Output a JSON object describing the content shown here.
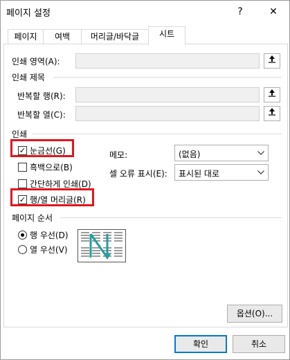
{
  "window": {
    "title": "페이지 설정",
    "help_label": "?",
    "close_label": "✕"
  },
  "tabs": [
    {
      "label": "페이지"
    },
    {
      "label": "여백"
    },
    {
      "label": "머리글/바닥글"
    },
    {
      "label": "시트"
    }
  ],
  "print_area": {
    "label": "인쇄 영역(A):",
    "value": ""
  },
  "print_titles": {
    "heading": "인쇄 제목",
    "rows_label": "반복할 행(R):",
    "cols_label": "반복할 열(C):"
  },
  "print": {
    "heading": "인쇄",
    "gridlines": {
      "label": "눈금선(G)",
      "checked": true
    },
    "black_white": {
      "label": "흑백으로(B)",
      "checked": false
    },
    "draft": {
      "label": "간단하게 인쇄(D)",
      "checked": false
    },
    "row_col_headings": {
      "label": "행/열 머리글(R)",
      "checked": true
    },
    "comments_label": "메모:",
    "comments_value": "(없음)",
    "cell_errors_label": "셀 오류 표시(E):",
    "cell_errors_value": "표시된 대로"
  },
  "page_order": {
    "heading": "페이지 순서",
    "down_then_over": {
      "label": "행 우선(D)",
      "selected": true
    },
    "over_then_down": {
      "label": "열 우선(V)",
      "selected": false
    }
  },
  "buttons": {
    "options": "옵션(O)...",
    "ok": "확인",
    "cancel": "취소"
  },
  "icons": {
    "ref_button": "collapse-dialog-icon",
    "dropdown": "chevron-down-icon",
    "check": "✓"
  },
  "colors": {
    "highlight": "#e1161c",
    "accent": "#0078d7",
    "arrow": "#1f9f9f"
  }
}
